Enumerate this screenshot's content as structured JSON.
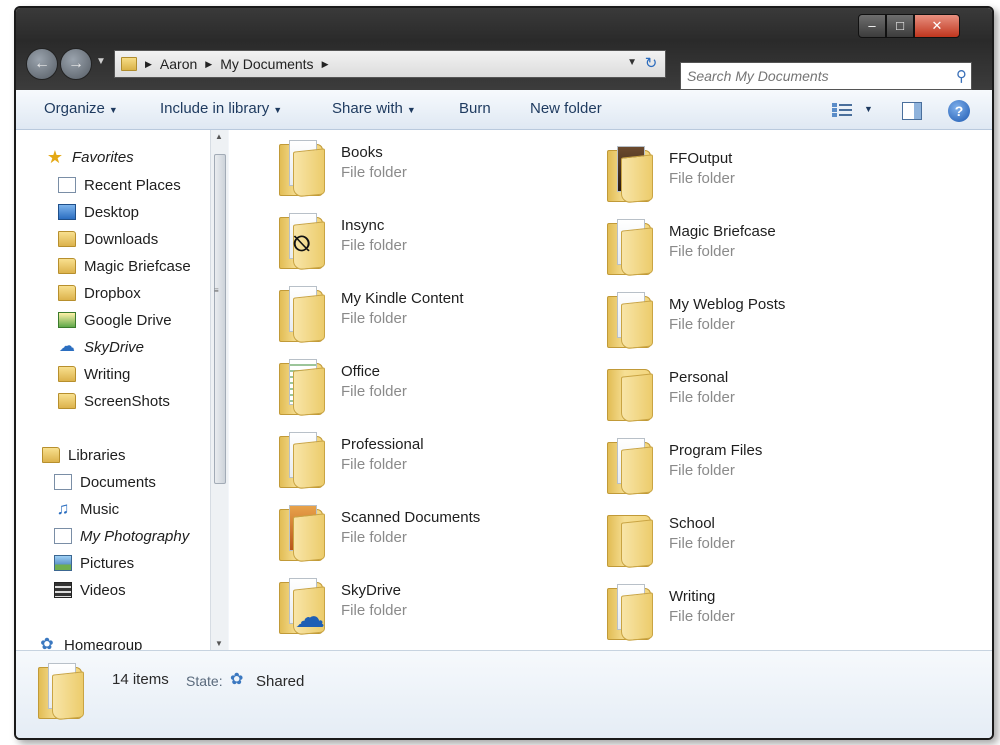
{
  "window": {
    "caption": {
      "minimize": "–",
      "maximize": "□",
      "close": "✕"
    }
  },
  "navbar": {
    "breadcrumb": [
      "Aaron",
      "My Documents"
    ],
    "search_placeholder": "Search My Documents"
  },
  "toolbar": {
    "organize": "Organize",
    "include_in_library": "Include in library",
    "share_with": "Share with",
    "burn": "Burn",
    "new_folder": "New folder"
  },
  "nav_pane": {
    "favorites": "Favorites",
    "favorites_items": [
      "Recent Places",
      "Desktop",
      "Downloads",
      "Magic Briefcase",
      "Dropbox",
      "Google Drive",
      "SkyDrive",
      "Writing",
      "ScreenShots"
    ],
    "libraries": "Libraries",
    "libraries_items": [
      "Documents",
      "Music",
      "My Photography",
      "Pictures",
      "Videos"
    ],
    "homegroup": "Homegroup"
  },
  "files": [
    {
      "name": "Books",
      "type": "File folder"
    },
    {
      "name": "FFOutput",
      "type": "File folder"
    },
    {
      "name": "Insync",
      "type": "File folder"
    },
    {
      "name": "Magic Briefcase",
      "type": "File folder"
    },
    {
      "name": "My Kindle Content",
      "type": "File folder"
    },
    {
      "name": "My Weblog Posts",
      "type": "File folder"
    },
    {
      "name": "Office",
      "type": "File folder"
    },
    {
      "name": "Personal",
      "type": "File folder"
    },
    {
      "name": "Professional",
      "type": "File folder"
    },
    {
      "name": "Program Files",
      "type": "File folder"
    },
    {
      "name": "Scanned Documents",
      "type": "File folder"
    },
    {
      "name": "School",
      "type": "File folder"
    },
    {
      "name": "SkyDrive",
      "type": "File folder"
    },
    {
      "name": "Writing",
      "type": "File folder"
    }
  ],
  "details": {
    "count": "14 items",
    "state_label": "State:",
    "state_value": "Shared"
  },
  "colors": {
    "folder": "#f3d67e",
    "accent": "#2b6ec0",
    "toolbar_text": "#1e3a5f",
    "secondary_text": "#8a8a8a"
  }
}
